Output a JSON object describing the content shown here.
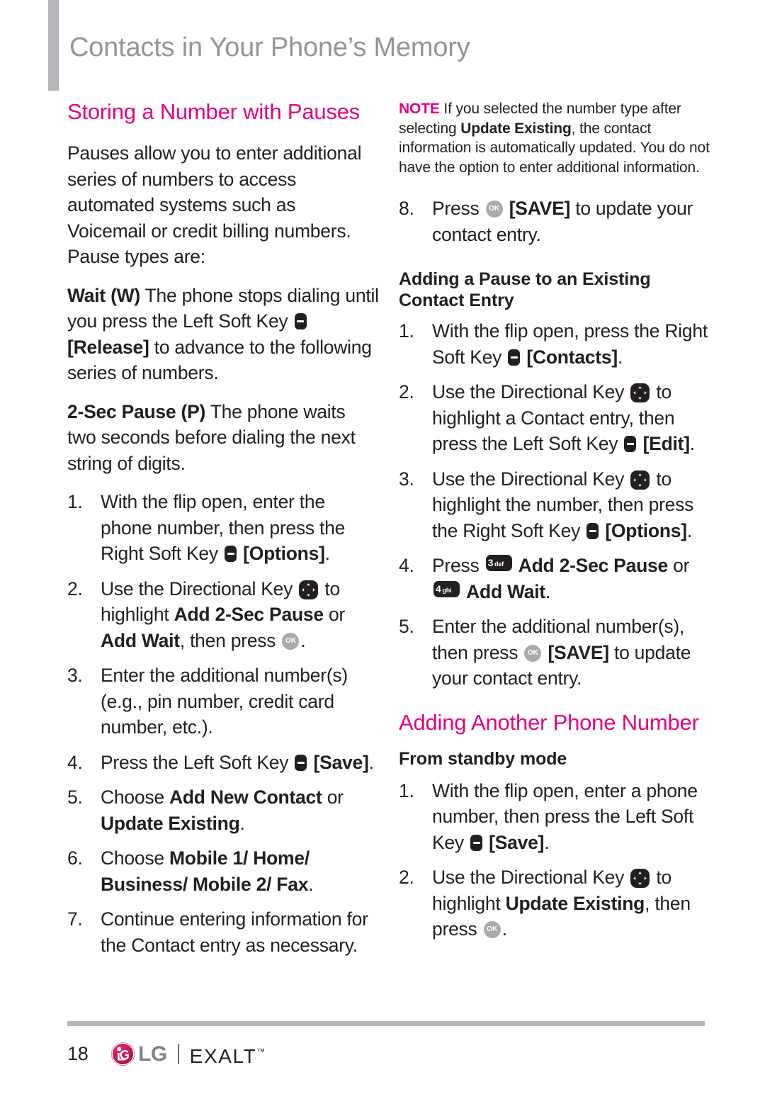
{
  "header": {
    "title": "Contacts in Your Phone’s Memory"
  },
  "left_column": {
    "heading": "Storing a Number with Pauses",
    "intro": "Pauses allow you to enter additional series of numbers to access automated systems such as Voicemail or credit billing numbers. Pause types are:",
    "wait_def": {
      "term": "Wait (W)",
      "part1": "The phone stops dialing until you press the Left Soft Key",
      "key": "soft-key-icon",
      "part2_bold": "[Release]",
      "part3": "to advance to the following series of numbers."
    },
    "pause_def": {
      "term": "2-Sec Pause (P)",
      "text": "The phone waits two seconds before dialing the next string of digits."
    },
    "steps": [
      {
        "num": "1.",
        "seg": [
          {
            "t": "With the flip open, enter the phone number, then press the Right Soft Key "
          },
          {
            "icon": "soft-key-icon"
          },
          {
            "t": " ",
            "b": false
          },
          {
            "t": "[Options]",
            "b": true
          },
          {
            "t": "."
          }
        ]
      },
      {
        "num": "2.",
        "seg": [
          {
            "t": "Use the Directional Key "
          },
          {
            "icon": "directional-key-icon"
          },
          {
            "t": " to highlight "
          },
          {
            "t": "Add 2-Sec Pause",
            "b": true
          },
          {
            "t": " or "
          },
          {
            "t": "Add Wait",
            "b": true
          },
          {
            "t": ", then press "
          },
          {
            "icon": "ok-key-icon"
          },
          {
            "t": "."
          }
        ]
      },
      {
        "num": "3.",
        "seg": [
          {
            "t": "Enter the additional number(s) (e.g., pin number, credit card number, etc.)."
          }
        ]
      },
      {
        "num": "4.",
        "seg": [
          {
            "t": "Press the Left Soft Key "
          },
          {
            "icon": "soft-key-icon"
          },
          {
            "t": " "
          },
          {
            "t": "[Save]",
            "b": true
          },
          {
            "t": "."
          }
        ]
      },
      {
        "num": "5.",
        "seg": [
          {
            "t": "Choose "
          },
          {
            "t": "Add New Contact",
            "b": true
          },
          {
            "t": " or "
          },
          {
            "t": "Update Existing",
            "b": true
          },
          {
            "t": "."
          }
        ]
      },
      {
        "num": "6.",
        "seg": [
          {
            "t": "Choose "
          },
          {
            "t": "Mobile 1/ Home/ Business/ Mobile 2/ Fax",
            "b": true
          },
          {
            "t": "."
          }
        ]
      },
      {
        "num": "7.",
        "seg": [
          {
            "t": "Continue entering information for the Contact entry as necessary."
          }
        ]
      }
    ]
  },
  "right_column": {
    "note": {
      "label": "NOTE",
      "part1": " If you selected the number type after selecting ",
      "bold": "Update Existing",
      "part2": ", the contact information is automatically updated. You do not have the option to enter additional information."
    },
    "step8": {
      "num": "8.",
      "seg": [
        {
          "t": "Press "
        },
        {
          "icon": "ok-key-icon"
        },
        {
          "t": " "
        },
        {
          "t": "[SAVE]",
          "b": true
        },
        {
          "t": " to update your contact entry."
        }
      ]
    },
    "heading_adding_pause": "Adding a Pause to an Existing Contact Entry",
    "steps_pause": [
      {
        "num": "1.",
        "seg": [
          {
            "t": "With the flip open, press the Right Soft Key "
          },
          {
            "icon": "soft-key-icon"
          },
          {
            "t": " "
          },
          {
            "t": "[Contacts]",
            "b": true
          },
          {
            "t": "."
          }
        ]
      },
      {
        "num": "2.",
        "seg": [
          {
            "t": "Use the Directional Key "
          },
          {
            "icon": "directional-key-icon"
          },
          {
            "t": " to highlight a Contact entry, then press the Left Soft Key "
          },
          {
            "icon": "soft-key-icon"
          },
          {
            "t": " "
          },
          {
            "t": "[Edit]",
            "b": true
          },
          {
            "t": "."
          }
        ]
      },
      {
        "num": "3.",
        "seg": [
          {
            "t": "Use the Directional Key "
          },
          {
            "icon": "directional-key-icon"
          },
          {
            "t": " to highlight the number, then press the Right Soft Key "
          },
          {
            "icon": "soft-key-icon"
          },
          {
            "t": " "
          },
          {
            "t": "[Options]",
            "b": true
          },
          {
            "t": "."
          }
        ]
      },
      {
        "num": "4.",
        "seg": [
          {
            "t": "Press "
          },
          {
            "icon": "num-key-3-def-icon"
          },
          {
            "t": " "
          },
          {
            "t": "Add 2-Sec Pause",
            "b": true
          },
          {
            "t": " or "
          },
          {
            "icon": "num-key-4-ghi-icon"
          },
          {
            "t": " "
          },
          {
            "t": "Add Wait",
            "b": true
          },
          {
            "t": "."
          }
        ]
      },
      {
        "num": "5.",
        "seg": [
          {
            "t": "Enter the additional number(s), then press "
          },
          {
            "icon": "ok-key-icon"
          },
          {
            "t": " "
          },
          {
            "t": "[SAVE]",
            "b": true
          },
          {
            "t": " to update your contact entry."
          }
        ]
      }
    ],
    "heading_adding_number": "Adding Another Phone Number",
    "subheading_standby": "From standby mode",
    "steps_standby": [
      {
        "num": "1.",
        "seg": [
          {
            "t": "With the flip open, enter a phone number, then press the Left Soft Key "
          },
          {
            "icon": "soft-key-icon"
          },
          {
            "t": " "
          },
          {
            "t": "[Save]",
            "b": true
          },
          {
            "t": "."
          }
        ]
      },
      {
        "num": "2.",
        "seg": [
          {
            "t": "Use the Directional Key "
          },
          {
            "icon": "directional-key-icon"
          },
          {
            "t": " to highlight "
          },
          {
            "t": "Update Existing",
            "b": true
          },
          {
            "t": ", then press "
          },
          {
            "icon": "ok-key-icon"
          },
          {
            "t": "."
          }
        ]
      }
    ]
  },
  "footer": {
    "page_number": "18",
    "brand": "LG",
    "product": "EXALT",
    "trademark": "™"
  },
  "key_icons": {
    "soft_key_label": "soft-key-icon",
    "directional_key_label": "directional-key-icon",
    "ok_key_text": "OK",
    "num_key_3_digit": "3",
    "num_key_3_letters": "def",
    "num_key_4_digit": "4",
    "num_key_4_letters": "ghi"
  },
  "colors": {
    "accent_pink": "#e6007e",
    "header_gray": "#939598",
    "rule_gray": "#b6b7bb",
    "body_black": "#231f20",
    "ok_key_gray": "#a7a9ac",
    "lg_crimson": "#c2185b"
  }
}
